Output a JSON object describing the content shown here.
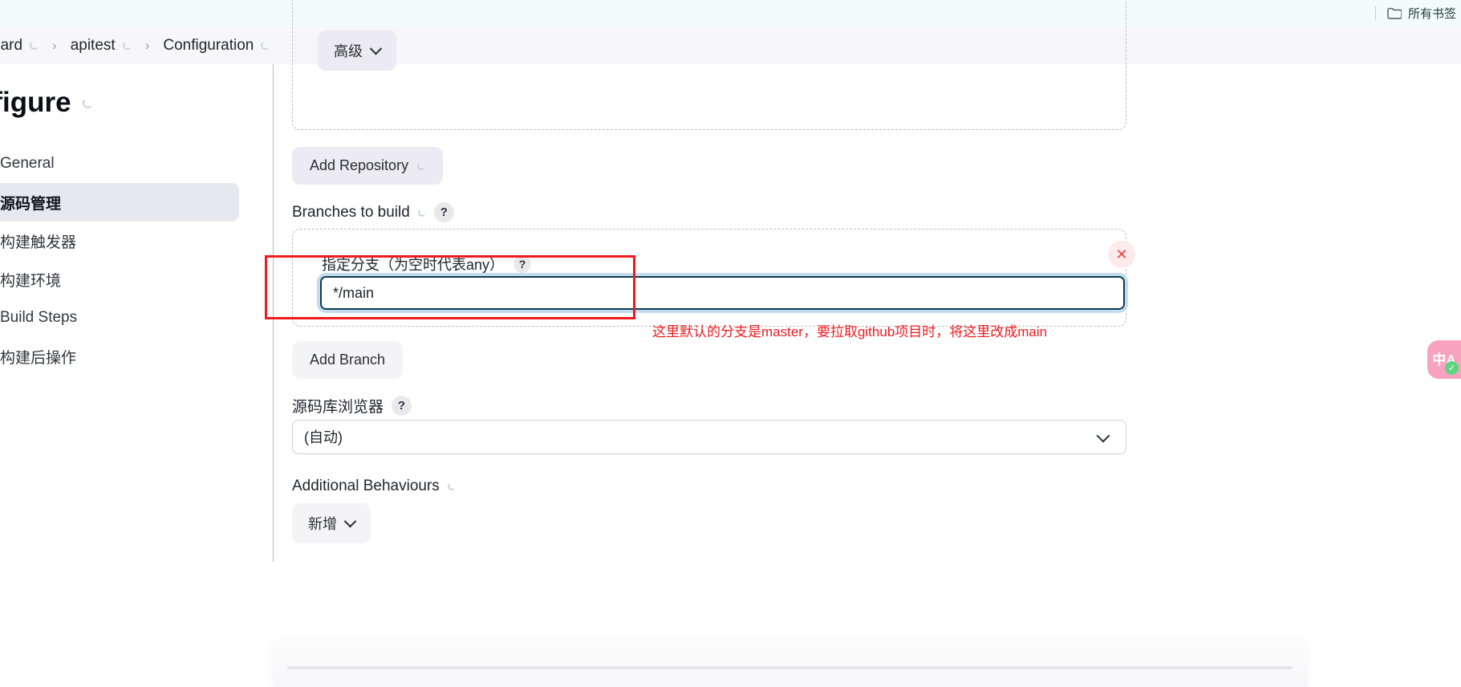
{
  "browser": {
    "bookmarks_label": "所有书签",
    "folder_icon": "folder-icon"
  },
  "breadcrumb": {
    "items": [
      {
        "label": "oard",
        "has_spinner": true
      },
      {
        "label": "apitest",
        "has_spinner": true
      },
      {
        "label": "Configuration",
        "has_spinner": true
      }
    ],
    "separator": "›"
  },
  "sidebar": {
    "title": "nfigure",
    "items": [
      {
        "label": "General",
        "active": false
      },
      {
        "label": "源码管理",
        "active": true
      },
      {
        "label": "构建触发器",
        "active": false
      },
      {
        "label": "构建环境",
        "active": false
      },
      {
        "label": "Build Steps",
        "active": false
      },
      {
        "label": "构建后操作",
        "active": false
      }
    ]
  },
  "main": {
    "advanced_button": "高级",
    "add_repository_button": "Add Repository",
    "branches_to_build_label": "Branches to build",
    "help_glyph": "?",
    "specify_branch_label": "指定分支（为空时代表any）",
    "branch_value": "*/main",
    "delete_glyph": "✕",
    "add_branch_button": "Add Branch",
    "repo_browser_label": "源码库浏览器",
    "repo_browser_value": "(自动)",
    "repo_browser_options": [
      "(自动)"
    ],
    "additional_behaviours_label": "Additional Behaviours",
    "add_behaviour_button": "新增"
  },
  "annotation": {
    "note_text": "这里默认的分支是master，要拉取github项目时，将这里改成main",
    "color": "#ee1c20"
  },
  "translate_widget": {
    "glyph": "中A",
    "check_glyph": "✓",
    "color": "#f9a2bf"
  }
}
